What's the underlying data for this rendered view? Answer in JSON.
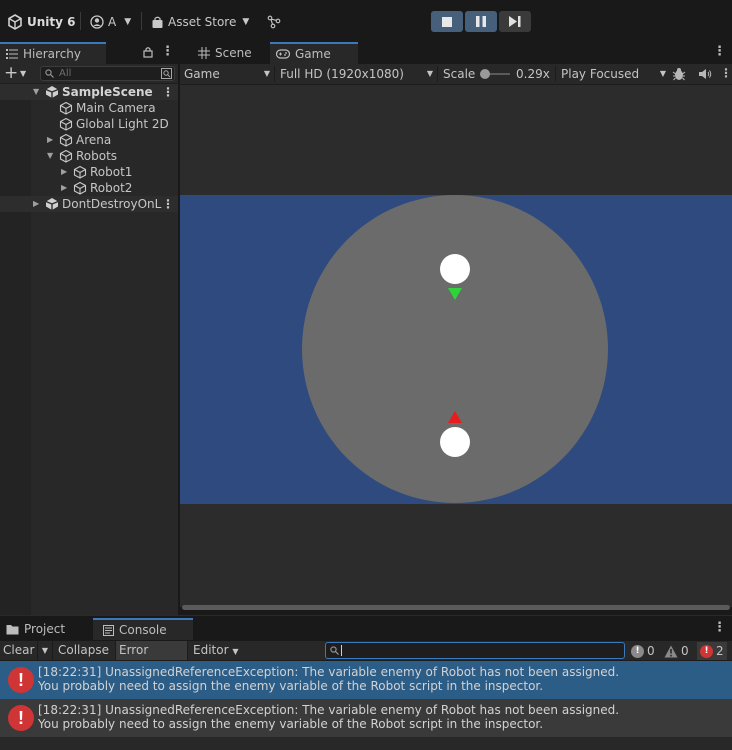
{
  "toolbar": {
    "app_title": "Unity 6",
    "account_label": "A",
    "asset_store_label": "Asset Store"
  },
  "hierarchy": {
    "tab_label": "Hierarchy",
    "search_placeholder": "All",
    "items": [
      {
        "label": "SampleScene"
      },
      {
        "label": "Main Camera"
      },
      {
        "label": "Global Light 2D"
      },
      {
        "label": "Arena"
      },
      {
        "label": "Robots"
      },
      {
        "label": "Robot1"
      },
      {
        "label": "Robot2"
      },
      {
        "label": "DontDestroyOnL"
      }
    ]
  },
  "view_tabs": {
    "scene": "Scene",
    "game": "Game"
  },
  "game_toolbar": {
    "display": "Game",
    "resolution": "Full HD (1920x1080)",
    "scale_label": "Scale",
    "scale_value": "0.29x",
    "play_mode": "Play Focused"
  },
  "bottom_tabs": {
    "project": "Project",
    "console": "Console"
  },
  "console": {
    "clear": "Clear",
    "collapse": "Collapse",
    "error_pause": "Error Pause",
    "editor": "Editor",
    "info_count": "0",
    "warning_count": "0",
    "error_count": "2",
    "logs": [
      {
        "line1": "[18:22:31] UnassignedReferenceException: The variable enemy of Robot has not been assigned.",
        "line2": "You probably need to assign the enemy variable of the Robot script in the inspector."
      },
      {
        "line1": "[18:22:31] UnassignedReferenceException: The variable enemy of Robot has not been assigned.",
        "line2": "You probably need to assign the enemy variable of the Robot script in the inspector."
      }
    ]
  },
  "colors": {
    "arena_background": "#2e4a7f",
    "arena_circle": "#6b6b6b",
    "robot_body": "#ffffff",
    "robot1_pointer": "#2fd43a",
    "robot2_pointer": "#e81c1c",
    "selected_row": "#2c5d87",
    "error": "#d03535"
  }
}
